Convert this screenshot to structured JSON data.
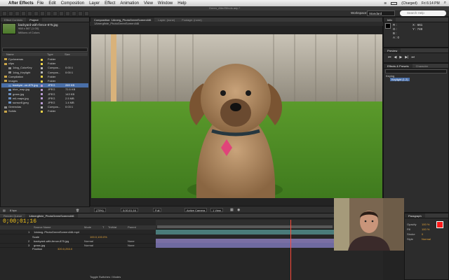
{
  "menubar": {
    "app": "After Effects",
    "items": [
      "File",
      "Edit",
      "Composition",
      "Layer",
      "Effect",
      "Animation",
      "View",
      "Window",
      "Help"
    ],
    "battery": "(Charged)",
    "clock": "Fri 6:14 PM"
  },
  "window_title": "Green_AfterEffects.aep *",
  "workspace": {
    "label": "Workspace:",
    "value": "Standard"
  },
  "search_help": {
    "placeholder": "Search Help"
  },
  "project": {
    "tabs": [
      "Project",
      "Effect Controls"
    ],
    "selected_name": "backyard-with-fence-875.jpg",
    "selected_meta": "968 x 567 (1.00)",
    "selected_colors": "Millions of Colors",
    "columns": [
      "Name",
      "Type",
      "Size"
    ],
    "rows": [
      {
        "name": "Cycloramas",
        "type": "Folder",
        "size": "",
        "tag": "#f0d54a",
        "kind": "folder",
        "indent": 0
      },
      {
        "name": "clips",
        "type": "Folder",
        "size": "",
        "tag": "#f0d54a",
        "kind": "folder",
        "indent": 0
      },
      {
        "name": "1dog_ColorKey",
        "type": "Compos...",
        "size": "0:00:1",
        "tag": "#b7b7b7",
        "kind": "comp",
        "indent": 1
      },
      {
        "name": "1dog_Keylight",
        "type": "Compos...",
        "size": "0:00:1",
        "tag": "#b7b7b7",
        "kind": "comp",
        "indent": 1
      },
      {
        "name": "Compilation",
        "type": "Folder",
        "size": "",
        "tag": "#f0d54a",
        "kind": "folder",
        "indent": 0
      },
      {
        "name": "Images",
        "type": "Folder",
        "size": "",
        "tag": "#f0d54a",
        "kind": "folder",
        "indent": 0
      },
      {
        "name": "backyar...ce-875.jpg",
        "type": "JPEG",
        "size": "269 KB",
        "tag": "#b89ad1",
        "kind": "file",
        "indent": 1,
        "selected": true
      },
      {
        "name": "blue_map.jpg",
        "type": "JPEG",
        "size": "72.5 KB",
        "tag": "#b89ad1",
        "kind": "file",
        "indent": 1
      },
      {
        "name": "grass.jpg",
        "type": "JPEG",
        "size": "143 KB",
        "tag": "#b89ad1",
        "kind": "file",
        "indent": 1
      },
      {
        "name": "mil-maps.jpg",
        "type": "JPEG",
        "size": "2.5 MB",
        "tag": "#b89ad1",
        "kind": "file",
        "indent": 1
      },
      {
        "name": "sunscr8.jpeg",
        "type": "JPEG",
        "size": "1.4 MB",
        "tag": "#b89ad1",
        "kind": "file",
        "indent": 1
      },
      {
        "name": "Greenclas",
        "type": "Compos...",
        "size": "0:03:1",
        "tag": "#b7b7b7",
        "kind": "comp",
        "indent": 0
      },
      {
        "name": "Solids",
        "type": "Folder",
        "size": "",
        "tag": "#f0d54a",
        "kind": "folder",
        "indent": 0
      }
    ],
    "bpc": "8 bpc"
  },
  "viewer": {
    "tabs": [
      "Composition: 1Ainerg_PhotoGreenScreen446",
      "Layer: (none)",
      "Footage: (none)"
    ],
    "sub_label": "1Ainergfinle_PhotoGreenScreen446",
    "zoom": "(75%)",
    "timecode": "0;00;01;16",
    "resolution": "Full",
    "camera": "Active Camera",
    "views": "1 View"
  },
  "info": {
    "tab": "Info",
    "r": "R :",
    "g": "G :",
    "b": "B :",
    "a": "A : 0",
    "x": "X : 661",
    "y": "Y : 748"
  },
  "preview": {
    "tab": "Preview"
  },
  "effects": {
    "tabs": [
      "Effects & Presets",
      "Character"
    ],
    "category": "Keying",
    "item": "Keylight (1.2)"
  },
  "timeline": {
    "tabs": [
      "Render Queue",
      "1Ainergfinle_PhotoGreenScreen446"
    ],
    "time": "0;00;01;16",
    "columns": [
      "Source Name",
      "Mode",
      "T",
      "TrkMat",
      "Parent"
    ],
    "layers": [
      {
        "num": "1",
        "name": "1dclarg..PhotoGreenScreen446.mp4",
        "mode": "Normal",
        "parent": "None",
        "color": "#4a7b7a"
      },
      {
        "num": "2",
        "name": "backyard-with-fence-875.jpg",
        "mode": "Normal",
        "parent": "None",
        "color": "#7a6fa3"
      },
      {
        "num": "3",
        "name": "grass.jpg",
        "mode": "Normal",
        "parent": "None",
        "color": "#6f6aa0"
      }
    ],
    "props": [
      {
        "name": "Scale",
        "value": "100.0,100.0%"
      },
      {
        "name": "Position",
        "value": "320.0,253.0"
      }
    ],
    "toggle": "Toggle Switches / Modes"
  },
  "right_bottom": {
    "tab": "Paragraph",
    "labels": [
      "Opacity",
      "Fill",
      "Stroke",
      "Style"
    ],
    "values": [
      "100 %",
      "100 %",
      "0",
      "Normal"
    ]
  },
  "colors": {
    "accent": "#f1c21b",
    "selection": "#4a6fa8",
    "playhead": "#ff4a3a",
    "fill_swatch": "#ff1a1a"
  }
}
